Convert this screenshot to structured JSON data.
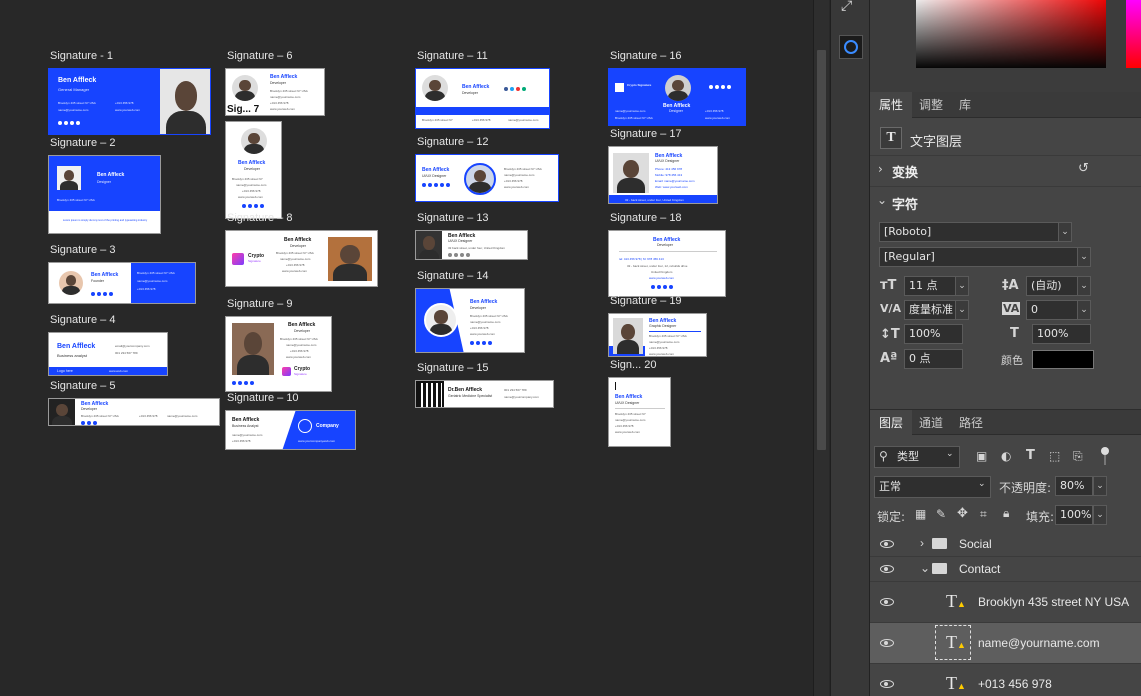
{
  "canvas": {
    "signatures": [
      {
        "label": "Signature - 1",
        "name": "Ben Affleck",
        "role": "General Manager",
        "address": "Brooklyn 435 street NY USA",
        "phone": "+013 456 978",
        "email": "name@yourname.com",
        "web": "www.yourweb.com"
      },
      {
        "label": "Signature – 2",
        "name": "Ben Affleck",
        "role": "Designer",
        "note": "Lorem ipsum is simply dummy text of the printing and typesetting industry"
      },
      {
        "label": "Signature – 3",
        "name": "Ben Affleck",
        "role": "Founder"
      },
      {
        "label": "Signature – 4",
        "name": "Ben Affleck",
        "role": "Business analyst",
        "email": "email@yourcompany.com",
        "phone": "001 234 567 789",
        "logo": "Logo here",
        "web": "www.web.com"
      },
      {
        "label": "Signature – 5",
        "name": "Ben Affleck",
        "role": "Developer"
      },
      {
        "label": "Signature – 6",
        "name": "Ben Affleck",
        "role": "Developer"
      },
      {
        "label": "Sig... 7",
        "name": "Ben Affleck",
        "role": "Developer"
      },
      {
        "label": "Signature – 8",
        "name": "Ben Affleck",
        "role": "Developer",
        "brand": "Crypto",
        "brand_sub": "Signature"
      },
      {
        "label": "Signature – 9",
        "name": "Ben Affleck",
        "role": "Developer",
        "brand": "Crypto",
        "brand_sub": "Signature"
      },
      {
        "label": "Signature – 10",
        "name": "Ben Affleck",
        "role": "Business Analyst",
        "company": "Company",
        "web": "www.yourcompanyweb.com"
      },
      {
        "label": "Signature – 11",
        "name": "Ben Affleck",
        "role": "Developer"
      },
      {
        "label": "Signature – 12",
        "name": "Ben Affleck",
        "role": "UI/UX Designer"
      },
      {
        "label": "Signature – 13",
        "name": "Ben Affleck",
        "role": "UI/UX Designer"
      },
      {
        "label": "Signature – 14",
        "name": "Ben Affleck",
        "role": "Developer"
      },
      {
        "label": "Signature – 15",
        "name": "Dr.Ben Affleck",
        "role": "Geriatric Medicine Specialist",
        "phone": "001 234 567 789",
        "email": "name@yourcompany.com"
      },
      {
        "label": "Signature – 16",
        "name": "Ben Affleck",
        "role": "Designer",
        "brand": "Crypto Signature"
      },
      {
        "label": "Signature – 17",
        "name": "Ben Affleck",
        "role": "UI/UX Designer"
      },
      {
        "label": "Signature – 18",
        "name": "Ben Affleck",
        "role": "Developer"
      },
      {
        "label": "Signature – 19",
        "name": "Ben Affleck",
        "role": "Graphic Designer"
      },
      {
        "label": "Sign... 20",
        "name": "Ben Affleck",
        "role": "UI/UX Designer"
      }
    ]
  },
  "properties": {
    "tabs": [
      "属性",
      "调整",
      "库"
    ],
    "active_tab": "属性",
    "layer_type": "文字图层",
    "transform_label": "变换",
    "character_label": "字符",
    "font_family": "[Roboto]",
    "font_style": "[Regular]",
    "font_size": "11 点",
    "leading": "(自动)",
    "kerning": "度量标准",
    "tracking": "0",
    "vertical_scale": "100%",
    "horizontal_scale": "100%",
    "baseline_shift": "0 点",
    "color_label": "颜色",
    "text_color": "#000000"
  },
  "layers": {
    "tabs": [
      "图层",
      "通道",
      "路径"
    ],
    "active_tab": "图层",
    "filter_kind": "类型",
    "blend_mode": "正常",
    "opacity_label": "不透明度:",
    "opacity": "80%",
    "lock_label": "锁定:",
    "fill_label": "填充:",
    "fill": "100%",
    "items": [
      {
        "name": "Social",
        "kind": "group",
        "expanded": false
      },
      {
        "name": "Contact",
        "kind": "group",
        "expanded": true
      },
      {
        "name": "Brooklyn 435 street NY USA",
        "kind": "text"
      },
      {
        "name": "name@yourname.com",
        "kind": "text",
        "selected": true
      },
      {
        "name": "+013 456 978",
        "kind": "text"
      }
    ]
  }
}
